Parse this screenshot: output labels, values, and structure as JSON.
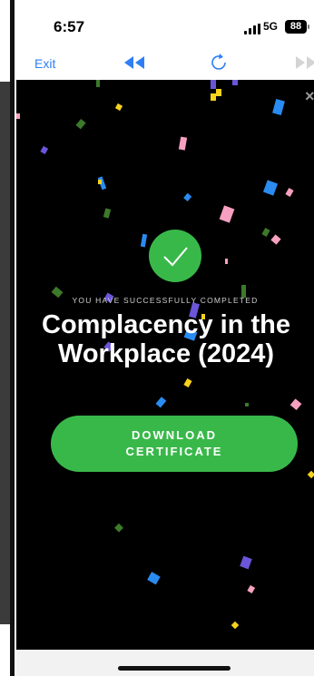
{
  "status_bar": {
    "time": "6:57",
    "network": "5G",
    "battery": "88"
  },
  "nav": {
    "exit_label": "Exit",
    "icons": {
      "rewind": "rewind-icon",
      "refresh": "refresh-icon",
      "forward": "fast-forward-icon"
    }
  },
  "main": {
    "completion_message": "YOU HAVE SUCCESSFULLY COMPLETED",
    "course_title": "Complacency in the Workplace (2024)",
    "download_label": "DOWNLOAD CERTIFICATE",
    "close_symbol": "×"
  },
  "colors": {
    "accent_green": "#39b84a",
    "link_blue": "#2f7ef5",
    "background": "#000000"
  }
}
